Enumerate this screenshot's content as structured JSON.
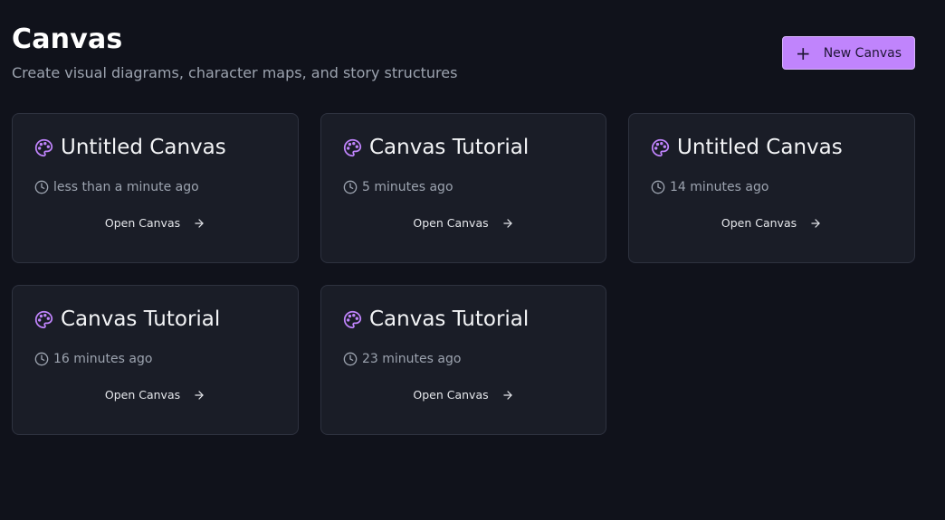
{
  "header": {
    "title": "Canvas",
    "subtitle": "Create visual diagrams, character maps, and story structures"
  },
  "new_button": {
    "label": "New Canvas",
    "icon": "plus-icon"
  },
  "cards": [
    {
      "title": "Untitled Canvas",
      "time": "less than a minute ago",
      "open_label": "Open Canvas"
    },
    {
      "title": "Canvas Tutorial",
      "time": "5 minutes ago",
      "open_label": "Open Canvas"
    },
    {
      "title": "Untitled Canvas",
      "time": "14 minutes ago",
      "open_label": "Open Canvas"
    },
    {
      "title": "Canvas Tutorial",
      "time": "16 minutes ago",
      "open_label": "Open Canvas"
    },
    {
      "title": "Canvas Tutorial",
      "time": "23 minutes ago",
      "open_label": "Open Canvas"
    }
  ],
  "colors": {
    "background": "#10121b",
    "card": "#1a1d27",
    "accent": "#c084fc",
    "muted_text": "#9ca3af"
  },
  "icons": {
    "card": "palette-icon",
    "time": "clock-icon",
    "open": "arrow-right-icon"
  }
}
